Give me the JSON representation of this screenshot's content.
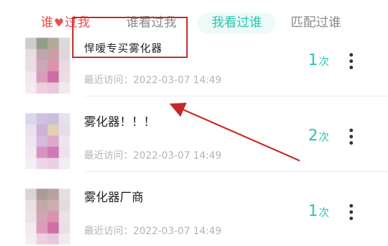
{
  "tabs": [
    {
      "label_pre": "谁",
      "label_post": "过我",
      "icon": "heart-icon"
    },
    {
      "label": "谁看过我"
    },
    {
      "label": "我看过谁",
      "active": true
    },
    {
      "label": "匹配过谁"
    }
  ],
  "records": [
    {
      "name": "悍嗳专买雾化器",
      "visit": "最近访问：2022-03-07 14:49",
      "count": "1",
      "unit": "次"
    },
    {
      "name": "雾化器！！！",
      "visit": "最近访问：2022-03-07 14:49",
      "count": "2",
      "unit": "次"
    },
    {
      "name": "雾化器厂商",
      "visit": "最近访问：2022-03-07 14:49",
      "count": "1",
      "unit": "次"
    }
  ],
  "colors": {
    "accent": "#27c5b3",
    "tab_red": "#ec4f4f",
    "annotation_red": "#c62828"
  }
}
